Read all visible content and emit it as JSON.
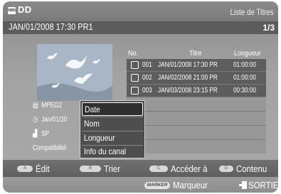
{
  "header": {
    "device": "DD",
    "hdd_icon_text": "HDD",
    "list_title": "Liste de Titres"
  },
  "info": {
    "current": "JAN/01/2008 17:30 PR1",
    "page": "1/3"
  },
  "details": {
    "format": "MPEG2",
    "date": "Jan/01/20",
    "mode": "SP",
    "compat": "Compatibilité"
  },
  "table": {
    "headers": {
      "no": "No.",
      "title": "Titre",
      "length": "Longueur"
    },
    "rows": [
      {
        "no": "001",
        "title": "JAN/01/2008 17:30 PR",
        "length": "01:00:00"
      },
      {
        "no": "002",
        "title": "JAN/02/2008 21:00 PR",
        "length": "01:00:00"
      },
      {
        "no": "003",
        "title": "JAN/03/2008 23:15 PR",
        "length": "00:30:00"
      }
    ]
  },
  "menu": {
    "items": [
      "Date",
      "Nom",
      "Longueur",
      "Info du canal"
    ],
    "selected": "Date"
  },
  "footer": {
    "a": {
      "key": "A",
      "label": "Édit"
    },
    "b": {
      "key": "B",
      "label": "Trier"
    },
    "c": {
      "key": "C",
      "label": "Accéder à"
    },
    "d": {
      "key": "D",
      "label": "Contenu"
    },
    "marker": {
      "key": "MARKER",
      "label": "Marqueur"
    },
    "exit": {
      "label": "SORTIE"
    }
  }
}
